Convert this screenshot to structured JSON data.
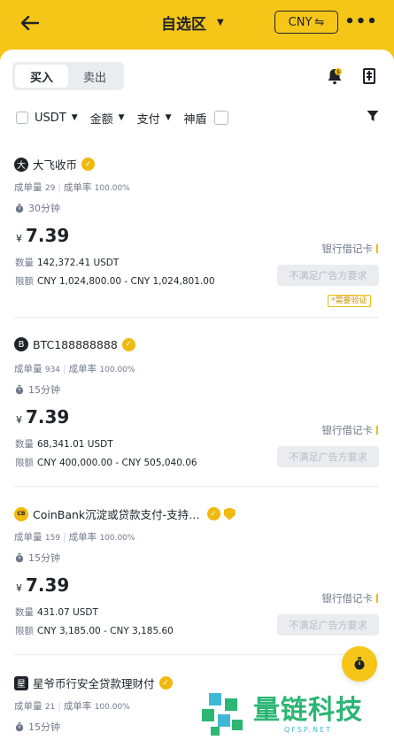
{
  "header": {
    "title": "自选区",
    "currency_button": "CNY",
    "colors": {
      "brand": "#f5c518",
      "accent": "#f0b90b"
    }
  },
  "tabs": {
    "buy": "买入",
    "sell": "卖出"
  },
  "filters": {
    "asset": "USDT",
    "amount": "金额",
    "payment": "支付",
    "shield": "神盾"
  },
  "ads": [
    {
      "merchant": "大飞收币",
      "avatar": "大",
      "orders_label": "成单量",
      "orders": "29",
      "rate_label": "成单率",
      "rate": "100.00%",
      "time": "30分钟",
      "currency_symbol": "¥",
      "price": "7.39",
      "qty_label": "数量",
      "qty": "142,372.41 USDT",
      "limit_label": "限额",
      "limit": "CNY 1,024,800.00 - CNY 1,024,801.00",
      "payment": "银行借记卡",
      "button": "不满足广告方要求",
      "tag": "*需要验证"
    },
    {
      "merchant": "BTC188888888",
      "avatar": "B",
      "orders_label": "成单量",
      "orders": "934",
      "rate_label": "成单率",
      "rate": "100.00%",
      "time": "15分钟",
      "currency_symbol": "¥",
      "price": "7.39",
      "qty_label": "数量",
      "qty": "68,341.01 USDT",
      "limit_label": "限额",
      "limit": "CNY 400,000.00 - CNY 505,040.06",
      "payment": "银行借记卡",
      "button": "不满足广告方要求"
    },
    {
      "merchant": "CoinBank沉淀或贷款支付-支持…",
      "avatar": "CB",
      "orders_label": "成单量",
      "orders": "159",
      "rate_label": "成单率",
      "rate": "100.00%",
      "time": "15分钟",
      "currency_symbol": "¥",
      "price": "7.39",
      "qty_label": "数量",
      "qty": "431.07 USDT",
      "limit_label": "限额",
      "limit": "CNY 3,185.00 - CNY 3,185.60",
      "payment": "银行借记卡",
      "button": "不满足广告方要求"
    },
    {
      "merchant": "星爷币行安全贷款理财付",
      "avatar": "星",
      "orders_label": "成单量",
      "orders": "21",
      "rate_label": "成单率",
      "rate": "100.00%",
      "time": "15分钟"
    }
  ],
  "watermark": {
    "title": "量链科技",
    "subtitle": "QFSP.NET"
  }
}
